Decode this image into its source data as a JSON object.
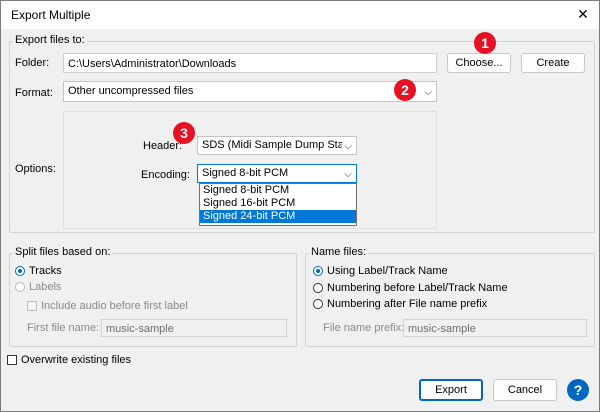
{
  "window": {
    "title": "Export Multiple",
    "close_glyph": "✕"
  },
  "export_to": {
    "legend": "Export files to:",
    "folder_label": "Folder:",
    "folder_value": "C:\\Users\\Administrator\\Downloads",
    "choose_label": "Choose...",
    "create_label": "Create",
    "format_label": "Format:",
    "format_value": "Other uncompressed files",
    "options_label": "Options:",
    "header_label": "Header:",
    "header_value": "SDS (Midi Sample Dump Stan",
    "encoding_label": "Encoding:",
    "encoding_value": "Signed 8-bit PCM",
    "encoding_options": [
      "Signed 8-bit PCM",
      "Signed 16-bit PCM",
      "Signed 24-bit PCM"
    ]
  },
  "badges": [
    "1",
    "2",
    "3"
  ],
  "split": {
    "legend": "Split files based on:",
    "tracks": "Tracks",
    "labels": "Labels",
    "include_audio": "Include audio before first label",
    "first_file_label": "First file name:",
    "first_file_value": "music-sample"
  },
  "name_files": {
    "legend": "Name files:",
    "opt1": "Using Label/Track Name",
    "opt2": "Numbering before Label/Track Name",
    "opt3": "Numbering after File name prefix",
    "prefix_label": "File name prefix:",
    "prefix_value": "music-sample"
  },
  "overwrite_label": "Overwrite existing files",
  "footer": {
    "export_label": "Export",
    "cancel_label": "Cancel",
    "help_glyph": "?"
  },
  "colors": {
    "badge": "#e81123",
    "accent": "#0067c0",
    "selection": "#0078d7"
  }
}
